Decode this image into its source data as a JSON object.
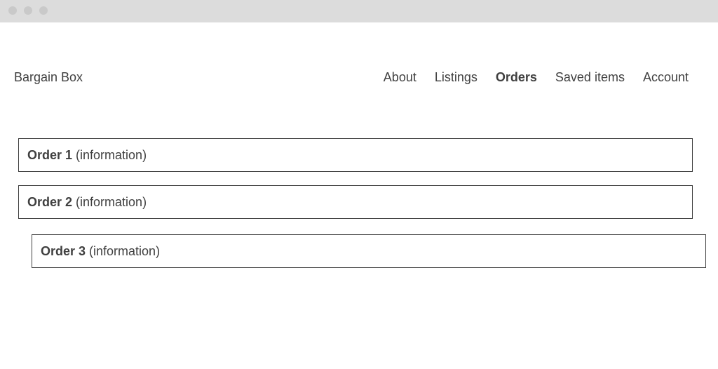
{
  "header": {
    "brand": "Bargain Box",
    "nav": [
      {
        "label": "About",
        "active": false
      },
      {
        "label": "Listings",
        "active": false
      },
      {
        "label": "Orders",
        "active": true
      },
      {
        "label": "Saved items",
        "active": false
      },
      {
        "label": "Account",
        "active": false
      }
    ]
  },
  "orders": [
    {
      "name": "Order 1",
      "info": "(information)"
    },
    {
      "name": "Order 2",
      "info": "(information)"
    },
    {
      "name": "Order 3",
      "info": "(information)"
    }
  ],
  "colors": {
    "window_bar": "#dcdcdc",
    "window_dot": "#c9c9c9",
    "text": "#404040",
    "border": "#404040",
    "background": "#ffffff"
  }
}
